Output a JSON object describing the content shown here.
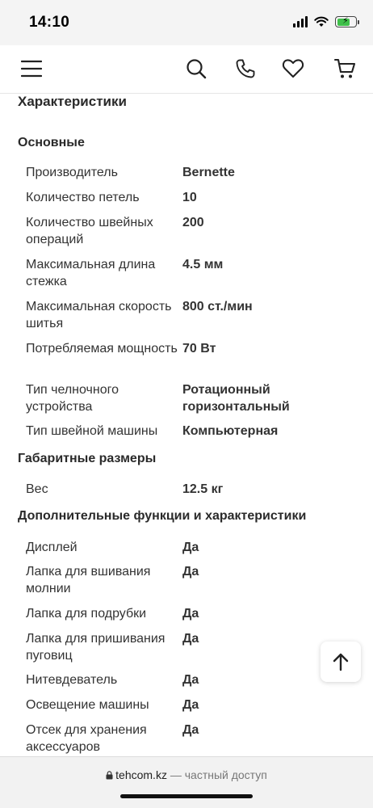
{
  "status_bar": {
    "time": "14:10",
    "battery_level": 0.7,
    "battery_color": "#3fc04a"
  },
  "header": {
    "icons": [
      "menu-icon",
      "search-icon",
      "phone-icon",
      "heart-icon",
      "cart-icon"
    ]
  },
  "characteristics": {
    "title": "Характеристики",
    "groups": [
      {
        "title": "Основные",
        "rows": [
          {
            "label": "Производитель",
            "value": "Bernette"
          },
          {
            "label": "Количество петель",
            "value": "10"
          },
          {
            "label": "Количество швейных операций",
            "value": "200"
          },
          {
            "label": "Максимальная длина стежка",
            "value": "4.5 мм"
          },
          {
            "label": "Максимальная скорость шитья",
            "value": "800 ст./мин"
          },
          {
            "label": "Потребляемая мощность",
            "value": "70 Вт"
          },
          {
            "label": "Тип челночного устройства",
            "value": "Ротационный горизонтальный"
          },
          {
            "label": "Тип швейной машины",
            "value": "Компьютерная"
          }
        ]
      },
      {
        "title": "Габаритные размеры",
        "rows": [
          {
            "label": "Вес",
            "value": "12.5 кг"
          }
        ]
      },
      {
        "title": "Дополнительные функции и характеристики",
        "rows": [
          {
            "label": "Дисплей",
            "value": "Да"
          },
          {
            "label": "Лапка для вшивания молнии",
            "value": "Да"
          },
          {
            "label": "Лапка для подрубки",
            "value": "Да"
          },
          {
            "label": "Лапка для пришивания пуговиц",
            "value": "Да"
          },
          {
            "label": "Нитевдеватель",
            "value": "Да"
          },
          {
            "label": "Освещение машины",
            "value": "Да"
          },
          {
            "label": "Отсек для хранения аксессуаров",
            "value": "Да"
          }
        ]
      }
    ]
  },
  "address_bar": {
    "domain": "tehcom.kz",
    "separator": "—",
    "privacy": "частный доступ"
  },
  "scroll_top_icon": "arrow-up-icon"
}
